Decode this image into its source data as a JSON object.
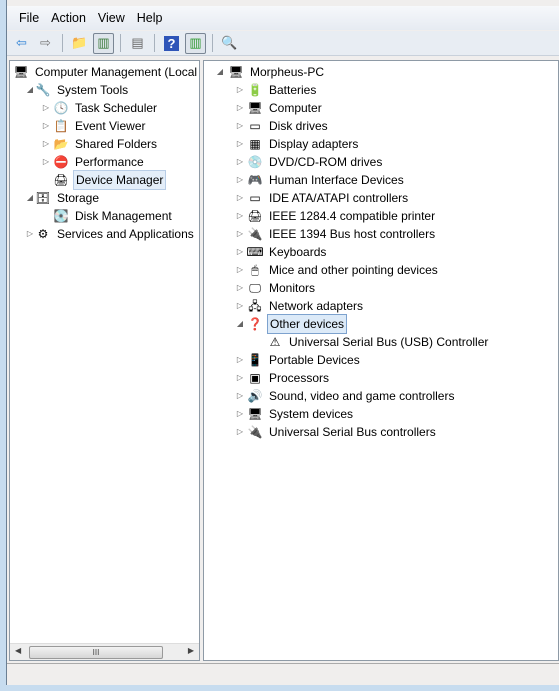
{
  "menu": [
    "File",
    "Action",
    "View",
    "Help"
  ],
  "toolbar": [
    {
      "icon": "back-arrow-icon",
      "glyph": "⇦",
      "color": "#2a7fd4"
    },
    {
      "icon": "forward-arrow-icon",
      "glyph": "⇨",
      "color": "#777777"
    },
    {
      "sep": true
    },
    {
      "icon": "up-folder-icon",
      "glyph": "📁",
      "color": "#d9a720"
    },
    {
      "icon": "show-hide-console-tree-icon",
      "glyph": "▥",
      "color": "#3b7a3b",
      "on": true
    },
    {
      "sep": true
    },
    {
      "icon": "properties-icon",
      "glyph": "▤",
      "color": "#666666"
    },
    {
      "sep": true
    },
    {
      "icon": "help-icon",
      "glyph": "?",
      "color": "#ffffff",
      "bg": "#2f55b8"
    },
    {
      "icon": "show-hide-action-pane-icon",
      "glyph": "▥",
      "color": "#2e9a2e",
      "on": true
    },
    {
      "sep": true
    },
    {
      "icon": "scan-hardware-icon",
      "glyph": "🔍",
      "color": "#3b6fb0"
    }
  ],
  "left_tree": [
    {
      "label": "Computer Management (Local",
      "icon": "computer-management-icon",
      "glyph": "🖥",
      "level": 0,
      "expander": ""
    },
    {
      "label": "System Tools",
      "icon": "tools-icon",
      "glyph": "🔧",
      "level": 1,
      "expander": "◢"
    },
    {
      "label": "Task Scheduler",
      "icon": "clock-icon",
      "glyph": "🕓",
      "level": 2,
      "expander": "▷"
    },
    {
      "label": "Event Viewer",
      "icon": "event-viewer-icon",
      "glyph": "📋",
      "level": 2,
      "expander": "▷"
    },
    {
      "label": "Shared Folders",
      "icon": "shared-folder-icon",
      "glyph": "📂",
      "level": 2,
      "expander": "▷"
    },
    {
      "label": "Performance",
      "icon": "performance-icon",
      "glyph": "⛔",
      "level": 2,
      "expander": "▷"
    },
    {
      "label": "Device Manager",
      "icon": "device-manager-icon",
      "glyph": "🖨",
      "level": 2,
      "expander": "",
      "selected": true
    },
    {
      "label": "Storage",
      "icon": "storage-icon",
      "glyph": "🗄",
      "level": 1,
      "expander": "◢"
    },
    {
      "label": "Disk Management",
      "icon": "disk-management-icon",
      "glyph": "💽",
      "level": 2,
      "expander": ""
    },
    {
      "label": "Services and Applications",
      "icon": "services-icon",
      "glyph": "⚙",
      "level": 1,
      "expander": "▷"
    }
  ],
  "right_tree": {
    "root": {
      "label": "Morpheus-PC",
      "icon": "computer-icon",
      "glyph": "🖥"
    },
    "items": [
      {
        "label": "Batteries",
        "icon": "battery-icon",
        "glyph": "🔋"
      },
      {
        "label": "Computer",
        "icon": "computer-icon",
        "glyph": "🖥"
      },
      {
        "label": "Disk drives",
        "icon": "disk-drive-icon",
        "glyph": "▭"
      },
      {
        "label": "Display adapters",
        "icon": "display-adapter-icon",
        "glyph": "▦"
      },
      {
        "label": "DVD/CD-ROM drives",
        "icon": "dvd-icon",
        "glyph": "💿"
      },
      {
        "label": "Human Interface Devices",
        "icon": "hid-icon",
        "glyph": "🎮"
      },
      {
        "label": "IDE ATA/ATAPI controllers",
        "icon": "ide-controller-icon",
        "glyph": "▭"
      },
      {
        "label": "IEEE 1284.4 compatible printer",
        "icon": "printer-icon",
        "glyph": "🖨"
      },
      {
        "label": "IEEE 1394 Bus host controllers",
        "icon": "firewire-icon",
        "glyph": "🔌"
      },
      {
        "label": "Keyboards",
        "icon": "keyboard-icon",
        "glyph": "⌨"
      },
      {
        "label": "Mice and other pointing devices",
        "icon": "mouse-icon",
        "glyph": "🖱"
      },
      {
        "label": "Monitors",
        "icon": "monitor-icon",
        "glyph": "🖵"
      },
      {
        "label": "Network adapters",
        "icon": "network-adapter-icon",
        "glyph": "🖧"
      },
      {
        "label": "Other devices",
        "icon": "unknown-device-icon",
        "glyph": "❓",
        "expanded": true,
        "selected": true,
        "children": [
          {
            "label": "Universal Serial Bus (USB) Controller",
            "icon": "warning-device-icon",
            "glyph": "⚠"
          }
        ]
      },
      {
        "label": "Portable Devices",
        "icon": "portable-device-icon",
        "glyph": "📱"
      },
      {
        "label": "Processors",
        "icon": "processor-icon",
        "glyph": "▣"
      },
      {
        "label": "Sound, video and game controllers",
        "icon": "sound-icon",
        "glyph": "🔊"
      },
      {
        "label": "System devices",
        "icon": "system-devices-icon",
        "glyph": "🖥"
      },
      {
        "label": "Universal Serial Bus controllers",
        "icon": "usb-icon",
        "glyph": "🔌"
      }
    ]
  },
  "scrollbar": {
    "thumb_grip": "III"
  }
}
